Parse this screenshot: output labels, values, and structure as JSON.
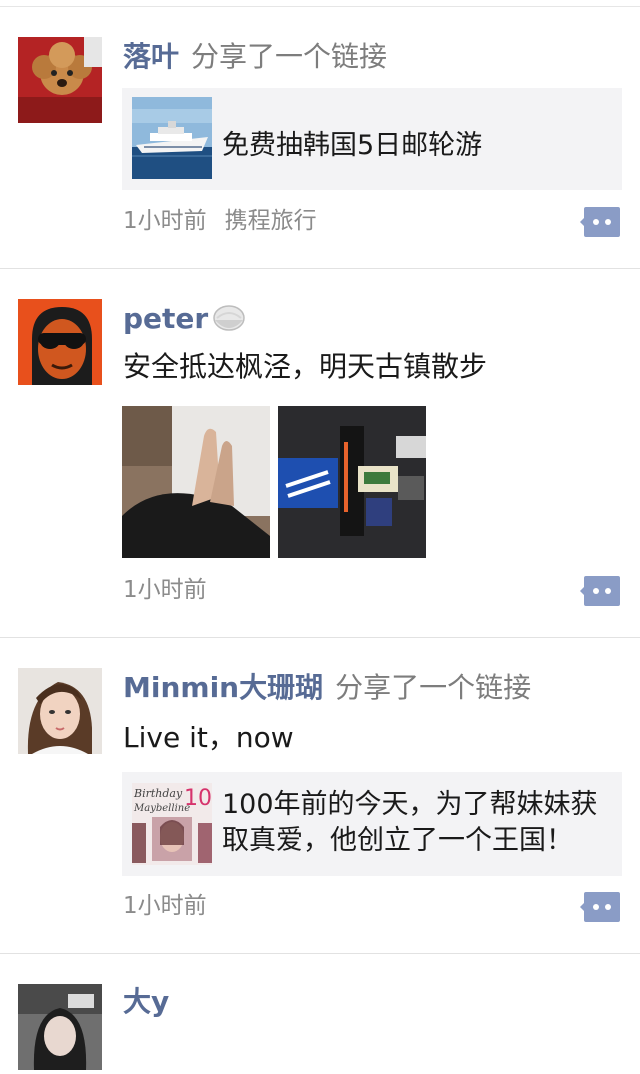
{
  "feed": {
    "posts": [
      {
        "author": "落叶",
        "action": "分享了一个链接",
        "link": {
          "title": "免费抽韩国5日邮轮游",
          "thumb_icon": "cruise-ship-thumb"
        },
        "time": "1小时前",
        "source": "携程旅行",
        "avatar_icon": "poodle-avatar"
      },
      {
        "author": "peter",
        "author_badge_icon": "rice-bowl-emoji-icon",
        "text": "安全抵达枫泾，明天古镇散步",
        "photos": [
          "feet-on-bed-photo",
          "travel-gear-photo"
        ],
        "time": "1小时前",
        "avatar_icon": "sunglasses-man-avatar"
      },
      {
        "author": "Minmin大珊瑚",
        "action": "分享了一个链接",
        "text": "Live it，now",
        "link": {
          "title_line1": "100年前的今天，为了帮妹妹获",
          "title_line2": "取真爱，他创立了一个王国！",
          "thumb_icon": "magazine-cover-thumb"
        },
        "time": "1小时前",
        "avatar_icon": "young-woman-avatar"
      },
      {
        "author": "大y",
        "avatar_icon": "woman-portrait-avatar"
      }
    ]
  },
  "colors": {
    "name_blue": "#576b95",
    "gray_text": "#8b8b8b",
    "card_bg": "#f3f3f5",
    "comment_icon": "#8a9cc6"
  }
}
